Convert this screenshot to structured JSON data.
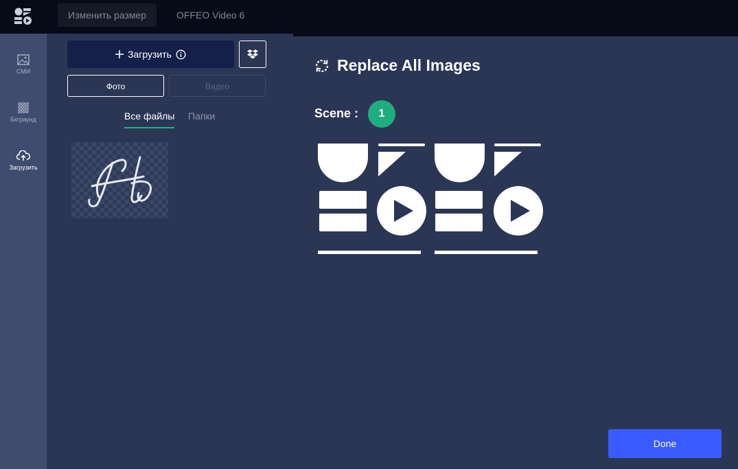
{
  "topbar": {
    "logo_icon": "offeo-logo-icon",
    "tabs": [
      "Изменить размер",
      "OFFEO Video 6"
    ]
  },
  "rail": {
    "items": [
      {
        "label": "СМИ",
        "icon": "image-icon"
      },
      {
        "label": "Бкграунд",
        "icon": "pattern-icon"
      },
      {
        "label": "Загрузить",
        "icon": "cloud-upload-icon"
      }
    ]
  },
  "panel": {
    "upload_label": "Загрузить",
    "dropbox_icon": "dropbox-icon",
    "type_tabs": [
      "Фото",
      "Видео"
    ],
    "file_tabs": [
      "Все файлы",
      "Папки"
    ]
  },
  "main": {
    "title": "Replace All Images",
    "scene_label": "Scene :",
    "scene_number": "1",
    "done_label": "Done"
  },
  "colors": {
    "accent_green": "#1fae80",
    "done_blue": "#3a5bff",
    "upload_dark": "#15204a"
  }
}
